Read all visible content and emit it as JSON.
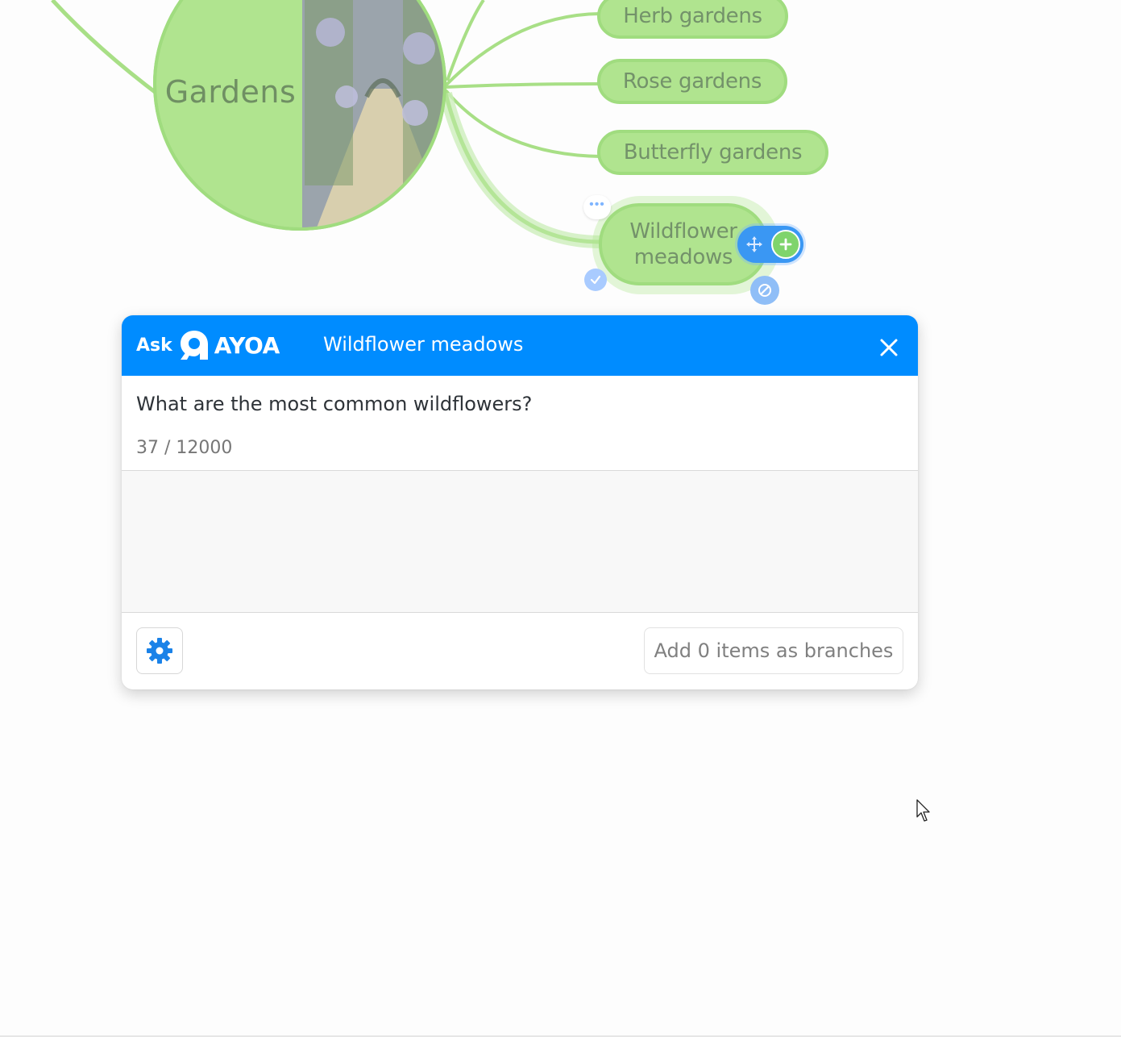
{
  "mindmap": {
    "central_topic": "Gardens",
    "branches": [
      {
        "label": "Herb gardens"
      },
      {
        "label": "Rose gardens"
      },
      {
        "label": "Butterfly gardens"
      },
      {
        "label_line1": "Wildflower",
        "label_line2": "meadows",
        "selected": true
      }
    ],
    "colors": {
      "node_fill": "#b0e48f",
      "node_border": "#a0dc7f",
      "node_text": "#73926a"
    }
  },
  "ask_panel": {
    "brand_prefix": "Ask",
    "brand_name": "AYOA",
    "title": "Wildflower meadows",
    "question": "What are the most common wildflowers?",
    "char_count": "37 / 12000",
    "add_button_label": "Add 0 items as branches",
    "accent_color": "#008cff"
  },
  "icons": [
    "more-icon",
    "check-icon",
    "link-icon",
    "move-icon",
    "add-icon",
    "close-icon",
    "gear-icon",
    "cursor-icon",
    "ayoa-logo-icon"
  ]
}
